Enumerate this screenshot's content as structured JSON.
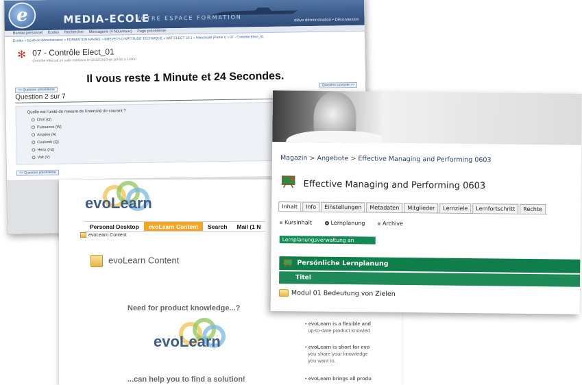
{
  "quiz_window": {
    "logo_letter": "e",
    "brand": "MEDIA-ECOLE",
    "tagline": "VOTRE ESPACE FORMATION",
    "user": "élève démonstration • Déconnexion",
    "menu": [
      "Bureau personnel",
      "Ecoles",
      "Rechercher",
      "Messagerie (4 Nouveaux)",
      "Page précédente"
    ],
    "breadcrumb": "Ecoles » Ecole de démonstration » FORMATION NAVIRE » BREVETS D'APTITUDE TECHNIQUE » BAT ELECT 10.1 » l'électricité (Partie I) » 07 - Contrôle Elect_01",
    "title": "07 - Contrôle Elect_01",
    "subtitle": "Contrôle effectué en salle médiavia le 02/12/2010 de 10h30 à 13h00",
    "timer": "Il vous reste 1 Minute et 24 Secondes.",
    "prev_label": "<< Question précédente",
    "next_label": "Question suivante >>",
    "question_number": "Question 2 sur 7",
    "question_text": "Quelle est l'unité de mesure de l'intensité de courant ?",
    "options": [
      "Ohm (Ω)",
      "Puissance (W)",
      "Ampère (A)",
      "Coulomb (Q)",
      "Hertz (Hz)",
      "Volt (V)"
    ]
  },
  "evolearn_window": {
    "logo_text": "evoLearn",
    "nav": [
      "Personal Desktop",
      "evoLearn Content",
      "Search",
      "Mail (1 N"
    ],
    "breadcrumb": "evoLearn Content",
    "heading": "evoLearn Content",
    "need_text": "Need for product knowledge...?",
    "help_text": "...can help you to find a solution!",
    "bullets": [
      [
        "evoLearn is a flexible and",
        "up-to-date product knowled"
      ],
      [
        "evoLearn is short for evo",
        "you share your knowledge",
        "you want to."
      ],
      [
        "evoLearn brings all produ"
      ]
    ]
  },
  "lernplanung_window": {
    "breadcrumb": [
      "Magazin",
      "Angebote",
      "Effective Managing and Performing 0603"
    ],
    "breadcrumb_separator": ">",
    "title": "Effective Managing and Performing 0603",
    "tabs": [
      "Inhalt",
      "Info",
      "Einstellungen",
      "Metadaten",
      "Mitglieder",
      "Lernziele",
      "Lernfortschritt",
      "Rechte"
    ],
    "subtabs": [
      "Kursinhalt",
      "Lernplanung",
      "Archive"
    ],
    "admin_button": "Lernplanungsverwaltung an",
    "section_title": "Persönliche Lernplanung",
    "column_header": "Titel",
    "rows": [
      "Modul 01 Bedeutung von Zielen"
    ]
  },
  "colors": {
    "quiz_header": "#3e5f8e",
    "evolearn_accent": "#f5a623",
    "lernplanung_green": "#0f7e4a"
  }
}
